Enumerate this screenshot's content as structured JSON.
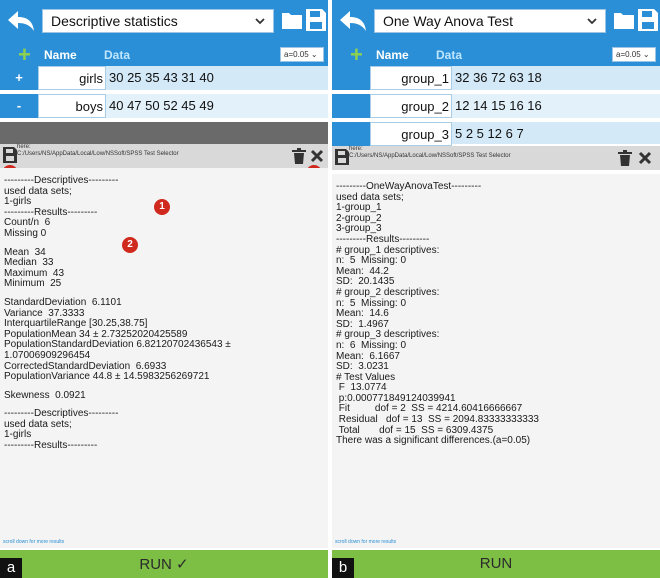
{
  "panel_a": {
    "test_name": "Descriptive statistics",
    "alpha": "a=0.05",
    "header": {
      "name": "Name",
      "data": "Data"
    },
    "rows": [
      {
        "button": "+",
        "name": "girls",
        "values": "30 25 35 43 31 40"
      },
      {
        "button": "-",
        "name": "boys",
        "values": "40 47 50 52 45 49"
      }
    ],
    "path": {
      "here": "here:",
      "path": "C:/Users/NS/AppData/Local/Low/NSSoft/SPSS Test Selector"
    },
    "badges": [
      "1",
      "2",
      "3",
      "4"
    ],
    "output": [
      "",
      "---------Descriptives---------",
      "used data sets;",
      "1-girls",
      "---------Results---------",
      "Count/n  6",
      "Missing 0",
      "",
      "Mean  34",
      "Median  33",
      "Maximum  43",
      "Minimum  25",
      "",
      "StandardDeviation  6.1101",
      "Variance  37.3333",
      "InterquartileRange [30.25,38.75]",
      "PopulationMean 34 ± 2.73252020425589",
      "PopulationStandardDeviation 6.82120702436543 ±",
      "1.07006909296454",
      "CorrectedStandardDeviation  6.6933",
      "PopulationVariance 44.8 ± 14.5983256269721",
      "",
      "Skewness  0.0921",
      "",
      "---------Descriptives---------",
      "used data sets;",
      "1-girls",
      "---------Results---------"
    ],
    "scroll_hint": "scroll down for more results",
    "run_label": "RUN ✓",
    "corner_label": "a"
  },
  "panel_b": {
    "test_name": "One Way Anova Test",
    "alpha": "a=0.05",
    "header": {
      "name": "Name",
      "data": "Data"
    },
    "rows": [
      {
        "button": "",
        "name": "group_1",
        "values": "32 36 72 63 18"
      },
      {
        "button": "",
        "name": "group_2",
        "values": "12 14 15 16 16"
      },
      {
        "button": "",
        "name": "group_3",
        "values": "5 2 5 12 6 7"
      }
    ],
    "path": {
      "here": "here:",
      "path": "C:/Users/NS/AppData/Local/Low/NSSoft/SPSS Test Selector"
    },
    "output": [
      "",
      "---------OneWayAnovaTest---------",
      "used data sets;",
      "1-group_1",
      "2-group_2",
      "3-group_3",
      "---------Results---------",
      "# group_1 descriptives:",
      "n:  5  Missing: 0",
      "Mean:  44.2",
      "SD:  20.1435",
      "# group_2 descriptives:",
      "n:  5  Missing: 0",
      "Mean:  14.6",
      "SD:  1.4967",
      "# group_3 descriptives:",
      "n:  6  Missing: 0",
      "Mean:  6.1667",
      "SD:  3.0231",
      "# Test Values",
      " F  13.0774",
      " p:0.000771849124039941",
      " Fit         dof = 2  SS = 4214.60416666667",
      " Residual   dof = 13  SS = 2094.83333333333",
      " Total       dof = 15  SS = 6309.4375",
      "There was a significant differences.(a=0.05)"
    ],
    "scroll_hint": "scroll down for more results",
    "run_label": "RUN",
    "corner_label": "b"
  },
  "colors": {
    "accent": "#2a8fd6",
    "run_green": "#7cbf44",
    "plus_green": "#8fd14f",
    "badge_red": "#d02a1e"
  }
}
